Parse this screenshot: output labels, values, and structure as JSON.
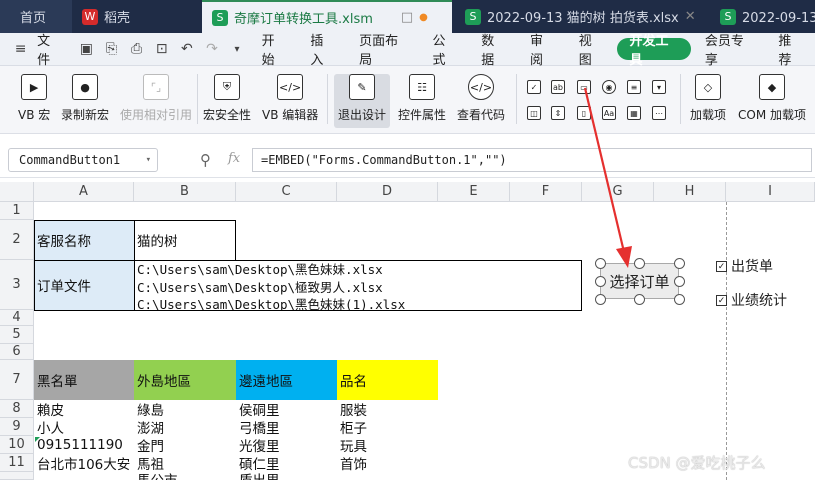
{
  "tabs": [
    {
      "label": "首页",
      "icon": "home-icon"
    },
    {
      "label": "稻壳",
      "icon": "wps-icon"
    },
    {
      "label": "奇摩订单转换工具.xlsm",
      "icon": "spreadsheet-icon"
    },
    {
      "label": "2022-09-13 猫的树 拍货表.xlsx",
      "icon": "spreadsheet-icon"
    },
    {
      "label": "2022-09-13 猫",
      "icon": "spreadsheet-icon"
    }
  ],
  "menu": {
    "file": "文件",
    "items": [
      "开始",
      "插入",
      "页面布局",
      "公式",
      "数据",
      "审阅",
      "视图",
      "开发工具",
      "会员专享",
      "推荐"
    ],
    "active": "开发工具"
  },
  "ribbon": {
    "buttons": [
      "VB 宏",
      "录制新宏",
      "使用相对引用",
      "宏安全性",
      "VB 编辑器",
      "退出设计",
      "控件属性",
      "查看代码",
      "加载项",
      "COM 加载项"
    ]
  },
  "formula_bar": {
    "name_box": "CommandButton1",
    "fx": "fx",
    "formula": "=EMBED(\"Forms.CommandButton.1\",\"\")"
  },
  "columns": [
    "A",
    "B",
    "C",
    "D",
    "E",
    "F",
    "G",
    "H",
    "I"
  ],
  "rows": [
    "1",
    "2",
    "3",
    "4",
    "5",
    "6",
    "7",
    "8",
    "9",
    "10",
    "11"
  ],
  "cells": {
    "A2": "客服名称",
    "B2": "猫的树",
    "A3": "订单文件",
    "B3_lines": [
      "C:\\Users\\sam\\Desktop\\黑色妹妹.xlsx",
      "C:\\Users\\sam\\Desktop\\極致男人.xlsx",
      "C:\\Users\\sam\\Desktop\\黑色妹妹(1).xlsx"
    ],
    "A7": "黑名單",
    "B7": "外島地區",
    "C7": "邊遠地區",
    "D7": "品名",
    "A8": "賴皮",
    "B8": "綠島",
    "C8": "侯硐里",
    "D8": "服裝",
    "A9": "小人",
    "B9": "澎湖",
    "C9": "弓橋里",
    "D9": "柜子",
    "A10": "0915111190",
    "B10": "金門",
    "C10": "光復里",
    "D10": "玩具",
    "A11": "台北市106大安",
    "B11": "馬祖",
    "C11": "碩仁里",
    "D11": "首饰",
    "A12": "",
    "B12": "馬公市",
    "C12": "盾出里",
    "D12": ""
  },
  "header_colors": {
    "A7": "#a6a6a6",
    "B7": "#92d050",
    "C7": "#00b0f0",
    "D7": "#ffff00"
  },
  "button_label": "选择订单",
  "checkboxes": [
    {
      "label": "出货单",
      "checked": true
    },
    {
      "label": "业绩统计",
      "checked": true
    }
  ],
  "watermark": "CSDN @爱吃桃子么"
}
